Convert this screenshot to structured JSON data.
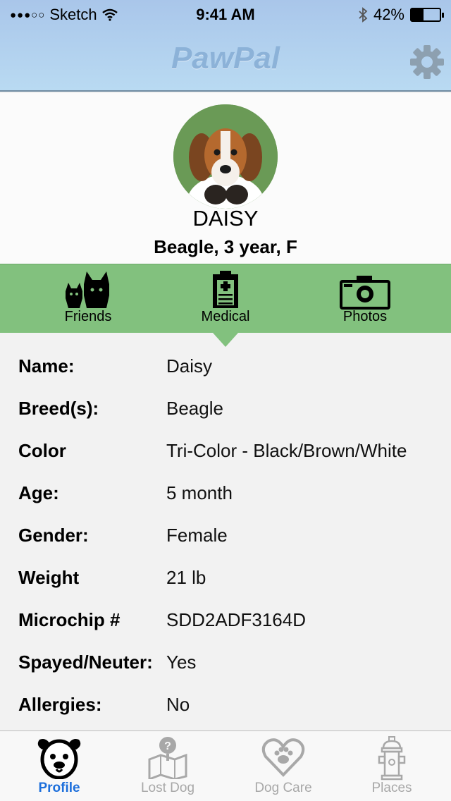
{
  "status_bar": {
    "carrier": "Sketch",
    "time": "9:41 AM",
    "battery_percent": "42%",
    "battery_level": 0.42
  },
  "header": {
    "title": "PawPal",
    "settings_icon": "gear-icon",
    "colors": {
      "background": "#b3d2ef",
      "title": "#8cb2d8"
    }
  },
  "profile": {
    "name": "DAISY",
    "description": "Beagle, 3 year, F"
  },
  "tabs": [
    {
      "label": "Friends",
      "icon": "friends-icon"
    },
    {
      "label": "Medical",
      "icon": "clipboard-icon",
      "selected": true
    },
    {
      "label": "Photos",
      "icon": "camera-icon"
    }
  ],
  "tabs_color": "#82c17e",
  "details": [
    {
      "label": "Name:",
      "value": "Daisy"
    },
    {
      "label": "Breed(s):",
      "value": "Beagle"
    },
    {
      "label": "Color",
      "value": "Tri-Color - Black/Brown/White"
    },
    {
      "label": "Age:",
      "value": "5 month"
    },
    {
      "label": "Gender:",
      "value": "Female"
    },
    {
      "label": "Weight",
      "value": "21 lb"
    },
    {
      "label": "Microchip #",
      "value": "SDD2ADF3164D"
    },
    {
      "label": "Spayed/Neuter:",
      "value": "Yes"
    },
    {
      "label": "Allergies:",
      "value": "No"
    }
  ],
  "tab_bar": [
    {
      "label": "Profile",
      "icon": "dog-face-icon",
      "active": true
    },
    {
      "label": "Lost Dog",
      "icon": "map-question-icon",
      "active": false
    },
    {
      "label": "Dog Care",
      "icon": "heart-paw-icon",
      "active": false
    },
    {
      "label": "Places",
      "icon": "fire-hydrant-icon",
      "active": false
    }
  ],
  "active_color": "#1d6fdb"
}
